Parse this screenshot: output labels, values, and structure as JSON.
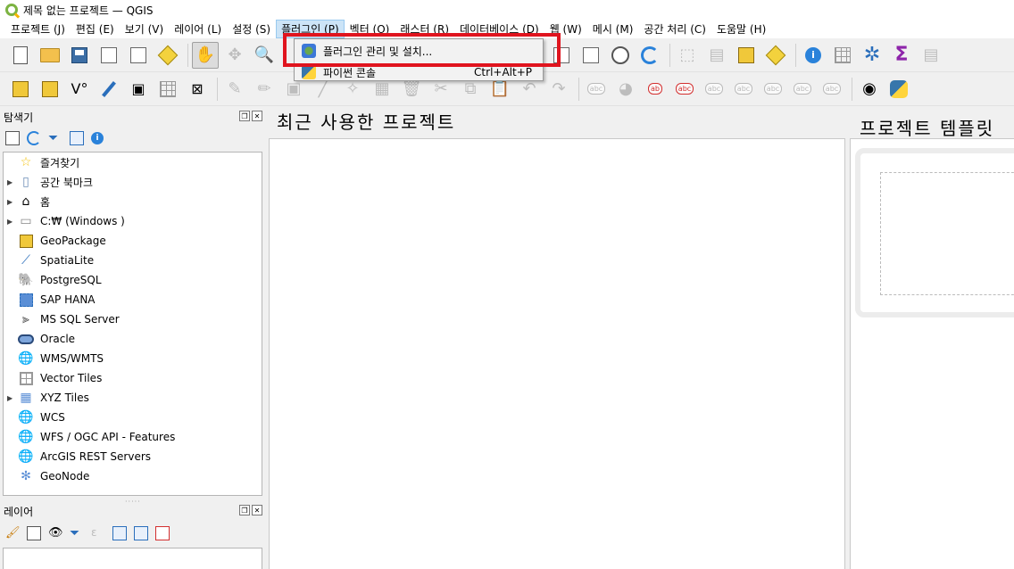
{
  "window": {
    "title": "제목 없는 프로젝트 — QGIS"
  },
  "menubar": {
    "items": [
      {
        "label": "프로젝트 (J)"
      },
      {
        "label": "편집 (E)"
      },
      {
        "label": "보기 (V)"
      },
      {
        "label": "레이어 (L)"
      },
      {
        "label": "설정 (S)"
      },
      {
        "label": "플러그인 (P)",
        "active": true
      },
      {
        "label": "벡터 (O)"
      },
      {
        "label": "래스터 (R)"
      },
      {
        "label": "데이터베이스 (D)"
      },
      {
        "label": "웹 (W)"
      },
      {
        "label": "메시 (M)"
      },
      {
        "label": "공간 처리 (C)"
      },
      {
        "label": "도움말 (H)"
      }
    ]
  },
  "plugin_menu": {
    "items": [
      {
        "label": "플러그인 관리 및 설치...",
        "icon": "plugin-icon",
        "shortcut": ""
      },
      {
        "label": "파이썬 콘솔",
        "icon": "python-icon",
        "shortcut": "Ctrl+Alt+P"
      }
    ]
  },
  "highlight_color": "#e0141e",
  "browser_panel": {
    "title": "탐색기",
    "items": [
      {
        "label": "즐겨찾기",
        "icon": "star-icon",
        "expandable": false
      },
      {
        "label": "공간 북마크",
        "icon": "bookmark-icon",
        "expandable": true
      },
      {
        "label": "홈",
        "icon": "home-icon",
        "expandable": true
      },
      {
        "label": "C:₩ (Windows )",
        "icon": "drive-icon",
        "expandable": true
      },
      {
        "label": "GeoPackage",
        "icon": "geopackage-icon",
        "expandable": false
      },
      {
        "label": "SpatiaLite",
        "icon": "spatialite-icon",
        "expandable": false
      },
      {
        "label": "PostgreSQL",
        "icon": "postgresql-icon",
        "expandable": false
      },
      {
        "label": "SAP HANA",
        "icon": "sap-hana-icon",
        "expandable": false
      },
      {
        "label": "MS SQL Server",
        "icon": "mssql-icon",
        "expandable": false
      },
      {
        "label": "Oracle",
        "icon": "oracle-icon",
        "expandable": false
      },
      {
        "label": "WMS/WMTS",
        "icon": "wms-globe-icon",
        "expandable": false
      },
      {
        "label": "Vector Tiles",
        "icon": "vector-tiles-icon",
        "expandable": false
      },
      {
        "label": "XYZ Tiles",
        "icon": "xyz-tiles-icon",
        "expandable": true
      },
      {
        "label": "WCS",
        "icon": "wcs-globe-icon",
        "expandable": false
      },
      {
        "label": "WFS / OGC API - Features",
        "icon": "wfs-globe-icon",
        "expandable": false
      },
      {
        "label": "ArcGIS REST Servers",
        "icon": "arcgis-globe-icon",
        "expandable": false
      },
      {
        "label": "GeoNode",
        "icon": "geonode-icon",
        "expandable": false
      }
    ]
  },
  "layers_panel": {
    "title": "레이어"
  },
  "welcome": {
    "recent_title": "최근 사용한 프로젝트",
    "template_title": "프로젝트 템플릿"
  }
}
